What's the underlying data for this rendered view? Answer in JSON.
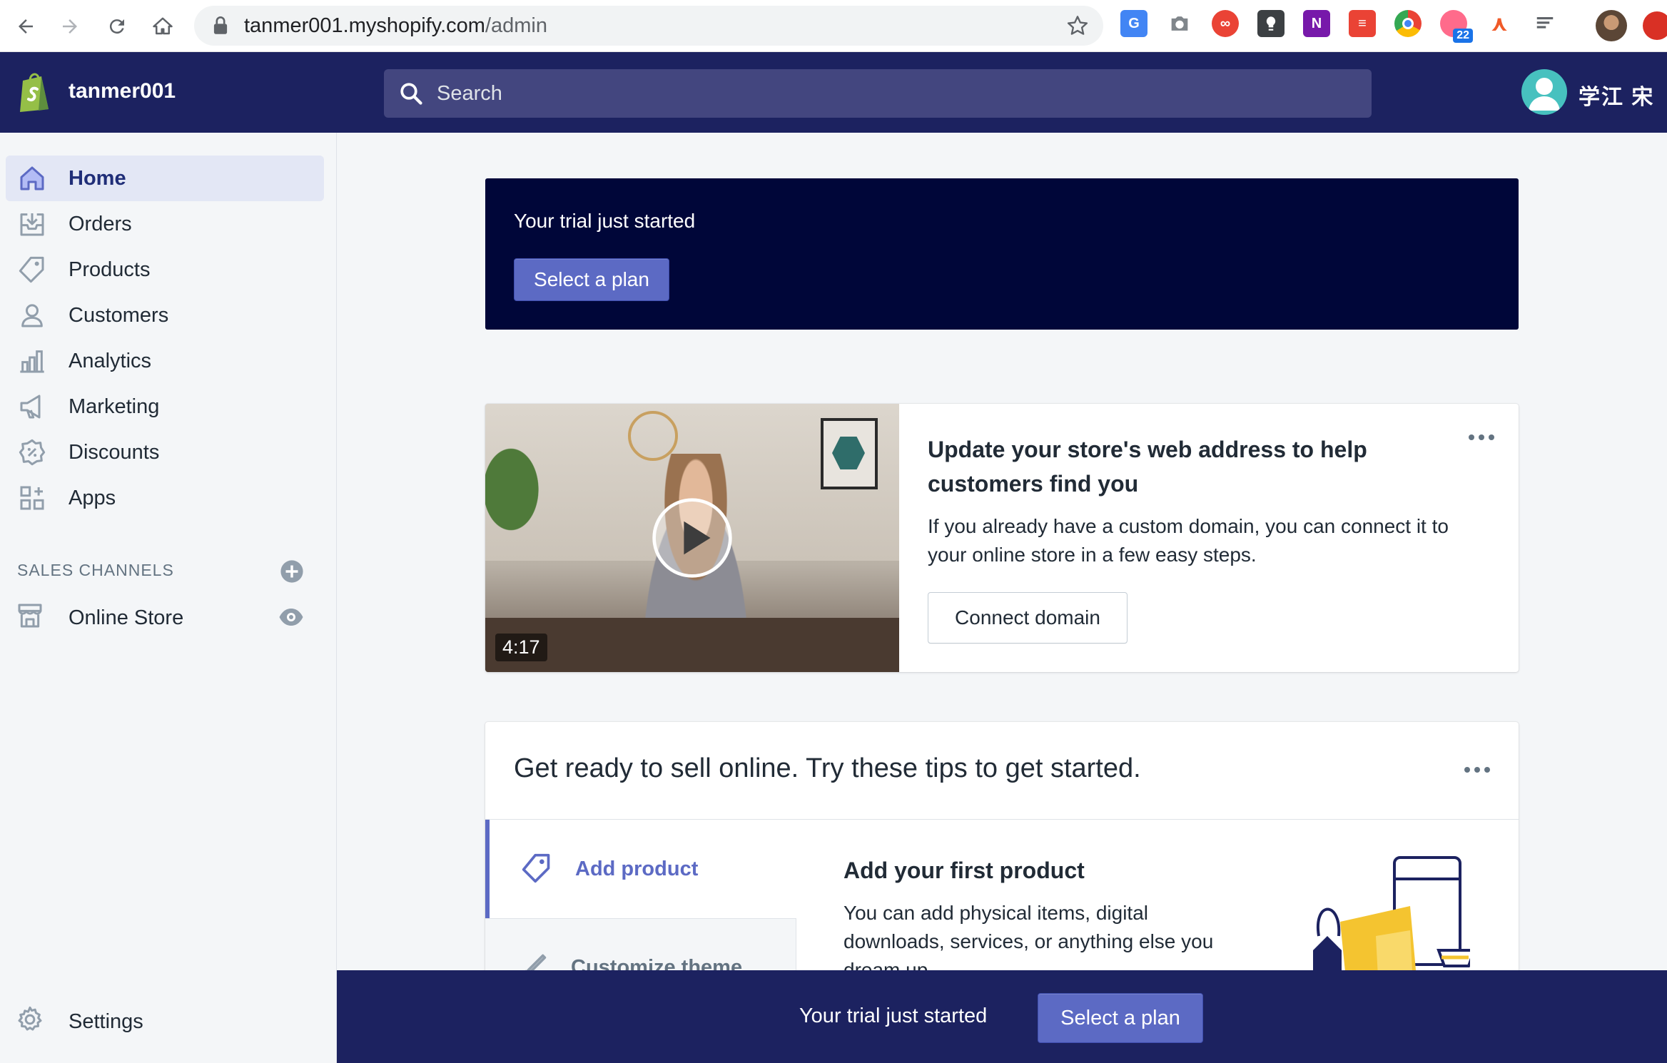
{
  "browser": {
    "url_host": "tanmer001.myshopify.com",
    "url_path": "/admin",
    "ext_badge_count": "22"
  },
  "topbar": {
    "shop_name": "tanmer001",
    "search_placeholder": "Search",
    "user_name": "学江 宋"
  },
  "sidebar": {
    "items": [
      {
        "label": "Home",
        "icon": "home-icon",
        "active": true
      },
      {
        "label": "Orders",
        "icon": "inbox-icon"
      },
      {
        "label": "Products",
        "icon": "tag-icon"
      },
      {
        "label": "Customers",
        "icon": "person-icon"
      },
      {
        "label": "Analytics",
        "icon": "bar-chart-icon"
      },
      {
        "label": "Marketing",
        "icon": "megaphone-icon"
      },
      {
        "label": "Discounts",
        "icon": "discount-badge-icon"
      },
      {
        "label": "Apps",
        "icon": "apps-grid-icon"
      }
    ],
    "sales_channels_header": "SALES CHANNELS",
    "online_store_label": "Online Store",
    "settings_label": "Settings"
  },
  "trial_banner": {
    "text": "Your trial just started",
    "button_label": "Select a plan"
  },
  "domain_card": {
    "video_duration": "4:17",
    "title": "Update your store's web address to help customers find you",
    "description": "If you already have a custom domain, you can connect it to your online store in a few easy steps.",
    "button_label": "Connect domain"
  },
  "tips_card": {
    "title": "Get ready to sell online. Try these tips to get started.",
    "tabs": [
      {
        "label": "Add product",
        "icon": "tag-icon"
      },
      {
        "label": "Customize theme",
        "icon": "brush-icon"
      }
    ],
    "content_title": "Add your first product",
    "content_description": "You can add physical items, digital downloads, services, or anything else you dream up."
  },
  "bottom_bar": {
    "text": "Your trial just started",
    "button_label": "Select a plan"
  },
  "colors": {
    "topbar": "#1c2260",
    "banner": "#000639",
    "accent": "#5c6ac4",
    "active_nav_bg": "#e3e7f5"
  }
}
